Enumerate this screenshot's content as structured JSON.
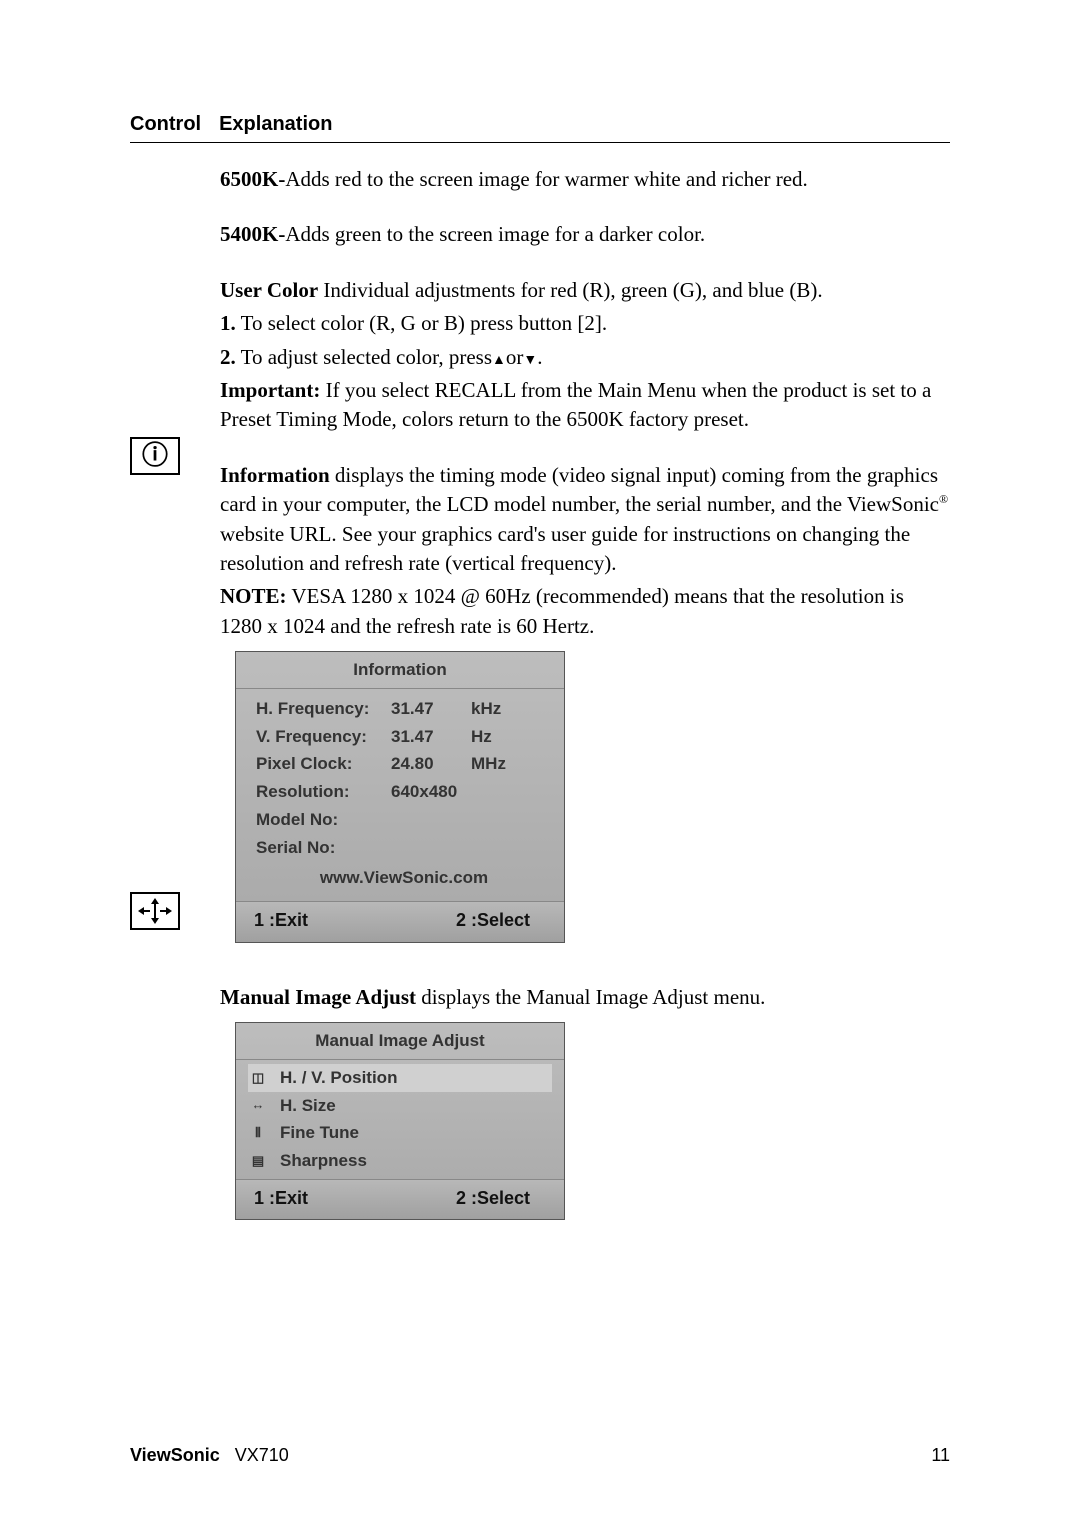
{
  "header": {
    "control": "Control",
    "explanation": "Explanation"
  },
  "s6500k": {
    "label": "6500K-",
    "text": "Adds red to the screen image for warmer white and richer red."
  },
  "s5400k": {
    "label": "5400K-",
    "text": "Adds green to the screen image for a darker color."
  },
  "usercolor": {
    "label": "User Color",
    "text": "  Individual adjustments for red (R), green (G),  and blue (B).",
    "step1_num": "1.",
    "step1_text": "  To select color (R, G or B) press button [2].",
    "step2_num": "2.",
    "step2_text": "  To adjust selected color, press",
    "step2_or": "or",
    "step2_end": ".",
    "important_label": "Important:",
    "important_text": " If you select RECALL from the Main Menu when the product is set to a Preset Timing Mode, colors return to the 6500K factory preset."
  },
  "info": {
    "label": "Information",
    "text_a": " displays the timing mode (video signal input) coming from the graphics card in your computer, the LCD model number, the serial number, and the ViewSonic",
    "reg": "®",
    "text_b": " website URL. See your graphics card's user guide for instructions on changing the resolution and refresh rate (vertical frequency).",
    "note_label": "NOTE:",
    "note_text": " VESA 1280 x 1024 @ 60Hz (recommended) means that the resolution is 1280 x 1024 and the refresh rate is 60 Hertz."
  },
  "osd_info": {
    "title": "Information",
    "rows": [
      {
        "label": "H. Frequency:",
        "value": "31.47",
        "unit": "kHz"
      },
      {
        "label": "V. Frequency:",
        "value": "31.47",
        "unit": "Hz"
      },
      {
        "label": "Pixel Clock:",
        "value": "24.80",
        "unit": "MHz"
      },
      {
        "label": "Resolution:",
        "value": "640x480",
        "unit": ""
      },
      {
        "label": "Model No:",
        "value": "",
        "unit": ""
      },
      {
        "label": "Serial No:",
        "value": "",
        "unit": ""
      }
    ],
    "url": "www.ViewSonic.com",
    "exit": "1 :Exit",
    "select": "2 :Select"
  },
  "mia": {
    "label": "Manual Image Adjust",
    "text": " displays the Manual Image Adjust menu."
  },
  "osd_mia": {
    "title": "Manual Image Adjust",
    "items": [
      "H. / V. Position",
      "H. Size",
      "Fine Tune",
      "Sharpness"
    ],
    "exit": "1 :Exit",
    "select": "2 :Select"
  },
  "footer": {
    "brand": "ViewSonic",
    "model": "VX710",
    "page": "11"
  }
}
